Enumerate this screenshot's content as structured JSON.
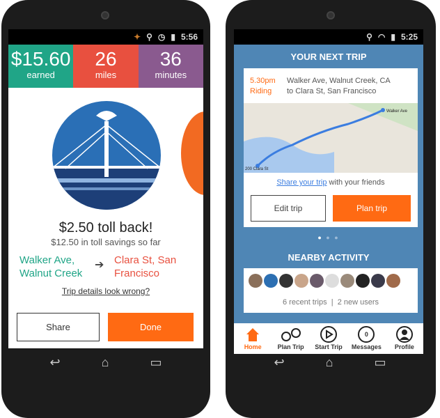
{
  "left": {
    "status_time": "5:56",
    "stats": [
      {
        "value": "$15.60",
        "label": "earned",
        "color": "#20a587"
      },
      {
        "value": "26",
        "label": "miles",
        "color": "#e8503f"
      },
      {
        "value": "36",
        "label": "minutes",
        "color": "#8a5a8f"
      }
    ],
    "toll_title": "$2.50 toll back!",
    "toll_sub": "$12.50 in toll savings so far",
    "from": "Walker Ave, Walnut Creek",
    "to": "Clara St, San Francisco",
    "wrong_link": "Trip details look wrong?",
    "share": "Share",
    "done": "Done"
  },
  "right": {
    "status_time": "5:25",
    "header": "YOUR NEXT TRIP",
    "time": "5.30pm",
    "mode": "Riding",
    "route_line1": "Walker Ave, Walnut Creek, CA",
    "route_line2": "to Clara St, San Francisco",
    "map_start": "Walker Ave",
    "map_end": "200 Clara St",
    "share_link": "Share your trip",
    "share_rest": " with your friends",
    "edit": "Edit trip",
    "plan": "Plan trip",
    "nearby": "NEARBY ACTIVITY",
    "recent": "6 recent trips",
    "new_users": "2 new users",
    "tabs": [
      {
        "label": "Home",
        "icon": "home-icon"
      },
      {
        "label": "Plan Trip",
        "icon": "route-icon"
      },
      {
        "label": "Start Trip",
        "icon": "play-icon"
      },
      {
        "label": "Messages",
        "icon": "message-icon",
        "badge": "0"
      },
      {
        "label": "Profile",
        "icon": "profile-icon"
      }
    ],
    "accent": "#ff6a13",
    "blue": "#4f86b5"
  }
}
